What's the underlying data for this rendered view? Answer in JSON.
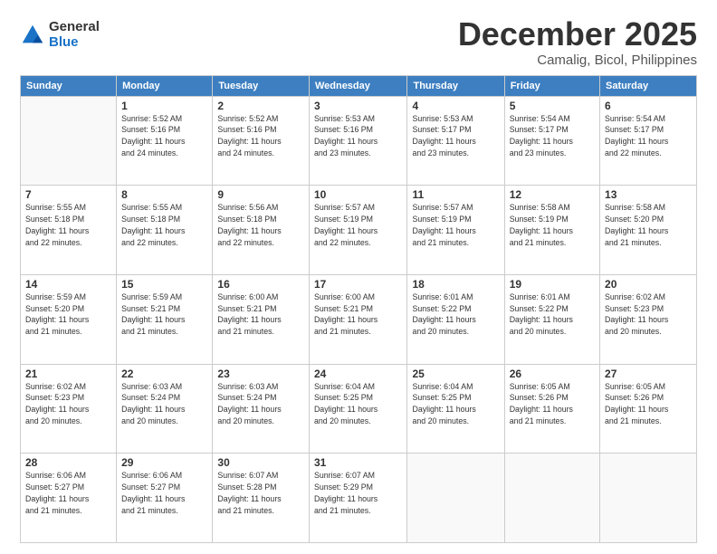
{
  "logo": {
    "general": "General",
    "blue": "Blue"
  },
  "header": {
    "month": "December 2025",
    "location": "Camalig, Bicol, Philippines"
  },
  "days_of_week": [
    "Sunday",
    "Monday",
    "Tuesday",
    "Wednesday",
    "Thursday",
    "Friday",
    "Saturday"
  ],
  "weeks": [
    [
      {
        "day": "",
        "info": ""
      },
      {
        "day": "1",
        "info": "Sunrise: 5:52 AM\nSunset: 5:16 PM\nDaylight: 11 hours\nand 24 minutes."
      },
      {
        "day": "2",
        "info": "Sunrise: 5:52 AM\nSunset: 5:16 PM\nDaylight: 11 hours\nand 24 minutes."
      },
      {
        "day": "3",
        "info": "Sunrise: 5:53 AM\nSunset: 5:16 PM\nDaylight: 11 hours\nand 23 minutes."
      },
      {
        "day": "4",
        "info": "Sunrise: 5:53 AM\nSunset: 5:17 PM\nDaylight: 11 hours\nand 23 minutes."
      },
      {
        "day": "5",
        "info": "Sunrise: 5:54 AM\nSunset: 5:17 PM\nDaylight: 11 hours\nand 23 minutes."
      },
      {
        "day": "6",
        "info": "Sunrise: 5:54 AM\nSunset: 5:17 PM\nDaylight: 11 hours\nand 22 minutes."
      }
    ],
    [
      {
        "day": "7",
        "info": "Sunrise: 5:55 AM\nSunset: 5:18 PM\nDaylight: 11 hours\nand 22 minutes."
      },
      {
        "day": "8",
        "info": "Sunrise: 5:55 AM\nSunset: 5:18 PM\nDaylight: 11 hours\nand 22 minutes."
      },
      {
        "day": "9",
        "info": "Sunrise: 5:56 AM\nSunset: 5:18 PM\nDaylight: 11 hours\nand 22 minutes."
      },
      {
        "day": "10",
        "info": "Sunrise: 5:57 AM\nSunset: 5:19 PM\nDaylight: 11 hours\nand 22 minutes."
      },
      {
        "day": "11",
        "info": "Sunrise: 5:57 AM\nSunset: 5:19 PM\nDaylight: 11 hours\nand 21 minutes."
      },
      {
        "day": "12",
        "info": "Sunrise: 5:58 AM\nSunset: 5:19 PM\nDaylight: 11 hours\nand 21 minutes."
      },
      {
        "day": "13",
        "info": "Sunrise: 5:58 AM\nSunset: 5:20 PM\nDaylight: 11 hours\nand 21 minutes."
      }
    ],
    [
      {
        "day": "14",
        "info": "Sunrise: 5:59 AM\nSunset: 5:20 PM\nDaylight: 11 hours\nand 21 minutes."
      },
      {
        "day": "15",
        "info": "Sunrise: 5:59 AM\nSunset: 5:21 PM\nDaylight: 11 hours\nand 21 minutes."
      },
      {
        "day": "16",
        "info": "Sunrise: 6:00 AM\nSunset: 5:21 PM\nDaylight: 11 hours\nand 21 minutes."
      },
      {
        "day": "17",
        "info": "Sunrise: 6:00 AM\nSunset: 5:21 PM\nDaylight: 11 hours\nand 21 minutes."
      },
      {
        "day": "18",
        "info": "Sunrise: 6:01 AM\nSunset: 5:22 PM\nDaylight: 11 hours\nand 20 minutes."
      },
      {
        "day": "19",
        "info": "Sunrise: 6:01 AM\nSunset: 5:22 PM\nDaylight: 11 hours\nand 20 minutes."
      },
      {
        "day": "20",
        "info": "Sunrise: 6:02 AM\nSunset: 5:23 PM\nDaylight: 11 hours\nand 20 minutes."
      }
    ],
    [
      {
        "day": "21",
        "info": "Sunrise: 6:02 AM\nSunset: 5:23 PM\nDaylight: 11 hours\nand 20 minutes."
      },
      {
        "day": "22",
        "info": "Sunrise: 6:03 AM\nSunset: 5:24 PM\nDaylight: 11 hours\nand 20 minutes."
      },
      {
        "day": "23",
        "info": "Sunrise: 6:03 AM\nSunset: 5:24 PM\nDaylight: 11 hours\nand 20 minutes."
      },
      {
        "day": "24",
        "info": "Sunrise: 6:04 AM\nSunset: 5:25 PM\nDaylight: 11 hours\nand 20 minutes."
      },
      {
        "day": "25",
        "info": "Sunrise: 6:04 AM\nSunset: 5:25 PM\nDaylight: 11 hours\nand 20 minutes."
      },
      {
        "day": "26",
        "info": "Sunrise: 6:05 AM\nSunset: 5:26 PM\nDaylight: 11 hours\nand 21 minutes."
      },
      {
        "day": "27",
        "info": "Sunrise: 6:05 AM\nSunset: 5:26 PM\nDaylight: 11 hours\nand 21 minutes."
      }
    ],
    [
      {
        "day": "28",
        "info": "Sunrise: 6:06 AM\nSunset: 5:27 PM\nDaylight: 11 hours\nand 21 minutes."
      },
      {
        "day": "29",
        "info": "Sunrise: 6:06 AM\nSunset: 5:27 PM\nDaylight: 11 hours\nand 21 minutes."
      },
      {
        "day": "30",
        "info": "Sunrise: 6:07 AM\nSunset: 5:28 PM\nDaylight: 11 hours\nand 21 minutes."
      },
      {
        "day": "31",
        "info": "Sunrise: 6:07 AM\nSunset: 5:29 PM\nDaylight: 11 hours\nand 21 minutes."
      },
      {
        "day": "",
        "info": ""
      },
      {
        "day": "",
        "info": ""
      },
      {
        "day": "",
        "info": ""
      }
    ]
  ]
}
